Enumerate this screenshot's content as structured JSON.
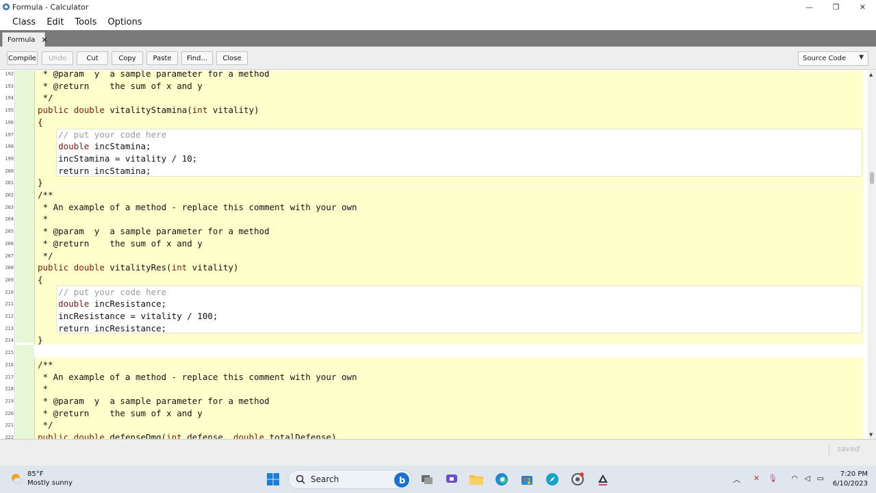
{
  "window": {
    "title": "Formula - Calculator"
  },
  "menu": [
    "Class",
    "Edit",
    "Tools",
    "Options"
  ],
  "tab": {
    "label": "Formula"
  },
  "toolbar": {
    "compile": "Compile",
    "undo": "Undo",
    "cut": "Cut",
    "copy": "Copy",
    "paste": "Paste",
    "find": "Find...",
    "close": "Close",
    "view_select": "Source Code"
  },
  "editor": {
    "lines": [
      {
        "n": "192",
        "text": " * @param  y  a sample parameter for a method"
      },
      {
        "n": "193",
        "text": " * @return    the sum of x and y"
      },
      {
        "n": "194",
        "text": " */"
      },
      {
        "n": "195",
        "text": "public double vitalityStamina(int vitality)"
      },
      {
        "n": "196",
        "text": "{"
      },
      {
        "n": "197",
        "text": "    // put your code here"
      },
      {
        "n": "198",
        "text": "    double incStamina;"
      },
      {
        "n": "199",
        "text": "    incStamina = vitality / 10;"
      },
      {
        "n": "200",
        "text": "    return incStamina;"
      },
      {
        "n": "201",
        "text": "}"
      },
      {
        "n": "202",
        "text": "/**"
      },
      {
        "n": "203",
        "text": " * An example of a method - replace this comment with your own"
      },
      {
        "n": "204",
        "text": " *"
      },
      {
        "n": "205",
        "text": " * @param  y  a sample parameter for a method"
      },
      {
        "n": "206",
        "text": " * @return    the sum of x and y"
      },
      {
        "n": "207",
        "text": " */"
      },
      {
        "n": "208",
        "text": "public double vitalityRes(int vitality)"
      },
      {
        "n": "209",
        "text": "{"
      },
      {
        "n": "210",
        "text": "    // put your code here"
      },
      {
        "n": "211",
        "text": "    double incResistance;"
      },
      {
        "n": "212",
        "text": "    incResistance = vitality / 100;"
      },
      {
        "n": "213",
        "text": "    return incResistance;"
      },
      {
        "n": "214",
        "text": "}"
      },
      {
        "n": "215",
        "text": ""
      },
      {
        "n": "216",
        "text": "/**"
      },
      {
        "n": "217",
        "text": " * An example of a method - replace this comment with your own"
      },
      {
        "n": "218",
        "text": " *"
      },
      {
        "n": "219",
        "text": " * @param  y  a sample parameter for a method"
      },
      {
        "n": "220",
        "text": " * @return    the sum of x and y"
      },
      {
        "n": "221",
        "text": " */"
      },
      {
        "n": "222",
        "text": "public double defenseDmg(int defense, double totalDefense)"
      }
    ]
  },
  "status": {
    "saved": "saved"
  },
  "taskbar": {
    "weather_temp": "85°F",
    "weather_desc": "Mostly sunny",
    "search_label": "Search",
    "time": "7:20 PM",
    "date": "6/10/2023"
  },
  "colors": {
    "scope_yellow": "#ffffcc",
    "scope_green": "#e6f7d6",
    "keyword": "#7a1a10",
    "comment": "#9a9a9a"
  }
}
